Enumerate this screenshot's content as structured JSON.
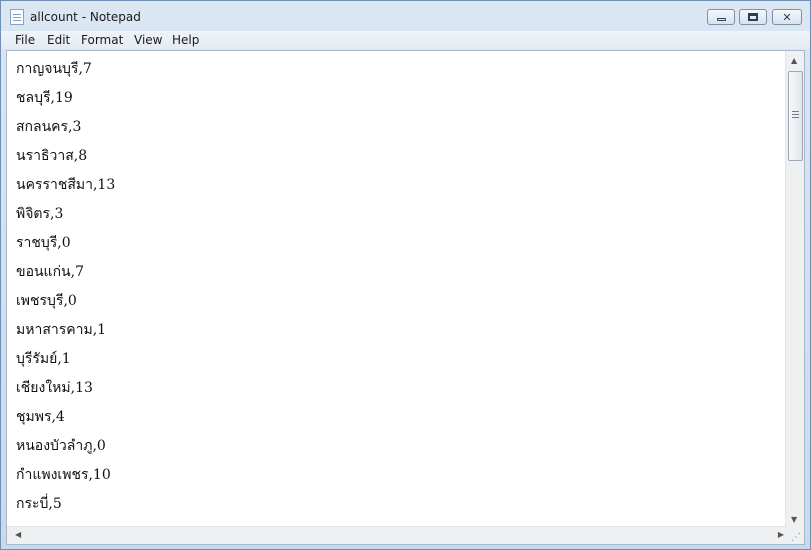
{
  "window": {
    "title": "allcount - Notepad",
    "icons": [
      "notepad-icon",
      "minimize-icon",
      "maximize-icon",
      "close-icon",
      "scroll-up-icon",
      "scroll-down-icon",
      "scroll-left-icon",
      "scroll-right-icon",
      "resize-grip-icon"
    ]
  },
  "menubar": {
    "items": [
      "File",
      "Edit",
      "Format",
      "View",
      "Help"
    ]
  },
  "editor": {
    "lines": [
      "กาญจนบุรี,7",
      "ชลบุรี,19",
      "สกลนคร,3",
      "นราธิวาส,8",
      "นครราชสีมา,13",
      "พิจิตร,3",
      "ราชบุรี,0",
      "ขอนแก่น,7",
      "เพชรบุรี,0",
      "มหาสารคาม,1",
      "บุรีรัมย์,1",
      "เชียงใหม่,13",
      "ชุมพร,4",
      "หนองบัวลำภู,0",
      "กำแพงเพชร,10",
      "กระบี่,5"
    ],
    "font": "Liberation Serif"
  },
  "colors": {
    "titlebar": "#c9d9ec",
    "border": "#6f8fb3",
    "menubar": "#e4ebf4"
  }
}
